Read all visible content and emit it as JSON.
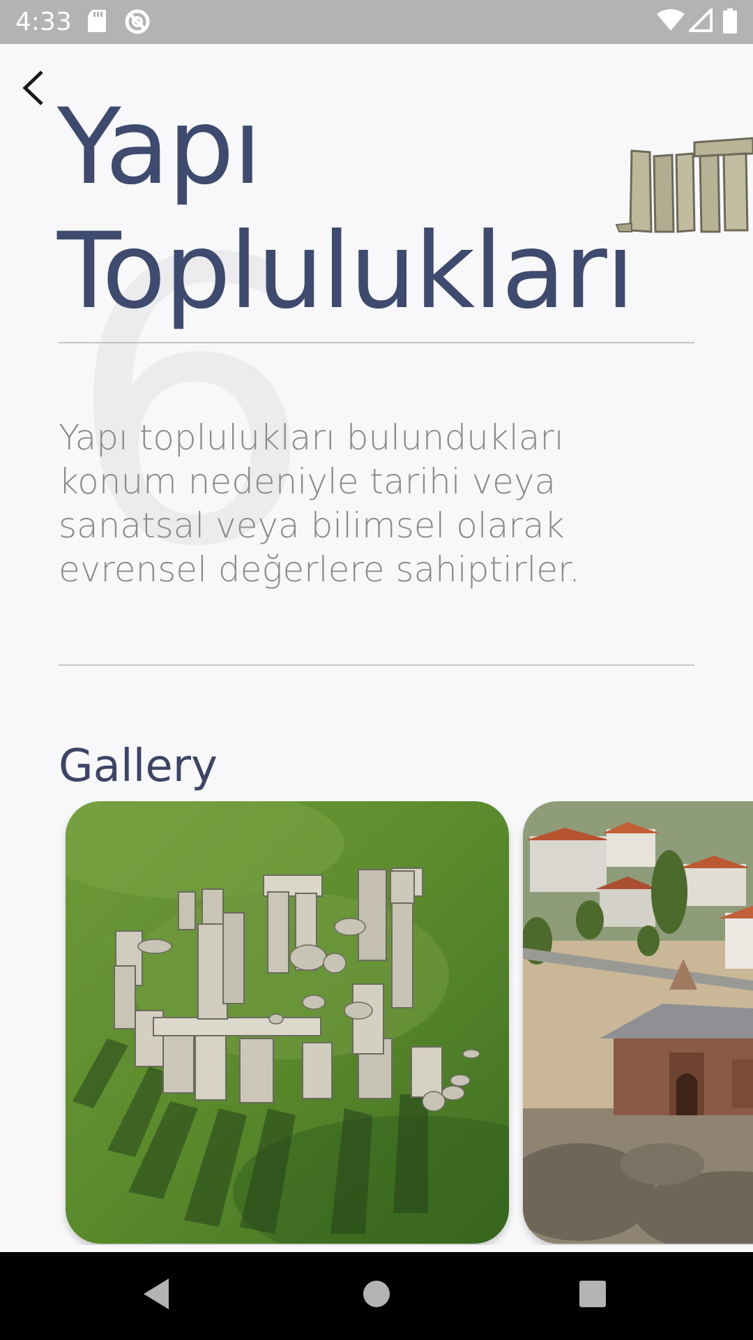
{
  "status_bar": {
    "time": "4:33",
    "icons": [
      "sd-card-icon",
      "sync-icon",
      "wifi-icon",
      "signal-icon",
      "battery-icon"
    ]
  },
  "header": {
    "back_icon": "chevron-left-icon",
    "title_line1": "Yapı",
    "title_line2": "Toplulukları",
    "illustration": "stonehenge-icon",
    "background_number": "6"
  },
  "description": "Yapı toplulukları bulundukları konum nedeniyle tarihi veya sanatsal veya bilimsel olarak evrensel değerlere sahiptirler.",
  "gallery": {
    "heading": "Gallery",
    "items": [
      {
        "image": "stonehenge-aerial-photo"
      },
      {
        "image": "historic-town-mosque-photo"
      }
    ]
  },
  "nav_bar": {
    "buttons": [
      "back-triangle-icon",
      "home-circle-icon",
      "recents-square-icon"
    ]
  },
  "colors": {
    "title": "#3e4a6e",
    "description": "#8a8a8e",
    "background": "#f8f8fa",
    "status_bar": "#b3b3b3"
  }
}
